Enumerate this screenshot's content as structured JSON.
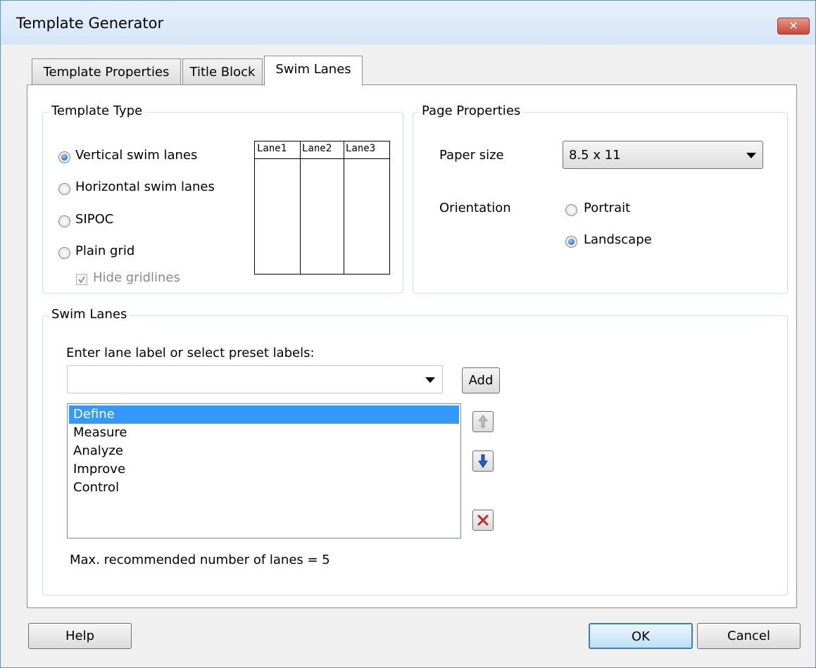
{
  "window": {
    "title": "Template Generator",
    "close_glyph": "✕"
  },
  "tabs": [
    {
      "label": "Template Properties",
      "active": false
    },
    {
      "label": "Title Block",
      "active": false
    },
    {
      "label": "Swim Lanes",
      "active": true
    }
  ],
  "template_type": {
    "legend": "Template Type",
    "options": [
      {
        "label": "Vertical swim lanes",
        "selected": true
      },
      {
        "label": "Horizontal swim lanes",
        "selected": false
      },
      {
        "label": "SIPOC",
        "selected": false
      },
      {
        "label": "Plain grid",
        "selected": false
      }
    ],
    "hide_gridlines": {
      "label": "Hide gridlines",
      "checked": true,
      "enabled": false
    },
    "preview_lanes": [
      "Lane1",
      "Lane2",
      "Lane3"
    ]
  },
  "page_properties": {
    "legend": "Page Properties",
    "paper_size_label": "Paper size",
    "paper_size_value": "8.5 x 11",
    "orientation_label": "Orientation",
    "orientation_options": [
      {
        "label": "Portrait",
        "selected": false
      },
      {
        "label": "Landscape",
        "selected": true
      }
    ]
  },
  "swim_lanes": {
    "legend": "Swim Lanes",
    "prompt": "Enter lane label or select preset labels:",
    "input_value": "",
    "add_label": "Add",
    "lanes": [
      "Define",
      "Measure",
      "Analyze",
      "Improve",
      "Control"
    ],
    "selected_index": 0,
    "max_note": "Max. recommended number of lanes = 5"
  },
  "footer": {
    "help_label": "Help",
    "ok_label": "OK",
    "cancel_label": "Cancel"
  },
  "colors": {
    "selection": "#3399ff",
    "title_bar": "#dbe8f7",
    "close": "#c9473a"
  }
}
